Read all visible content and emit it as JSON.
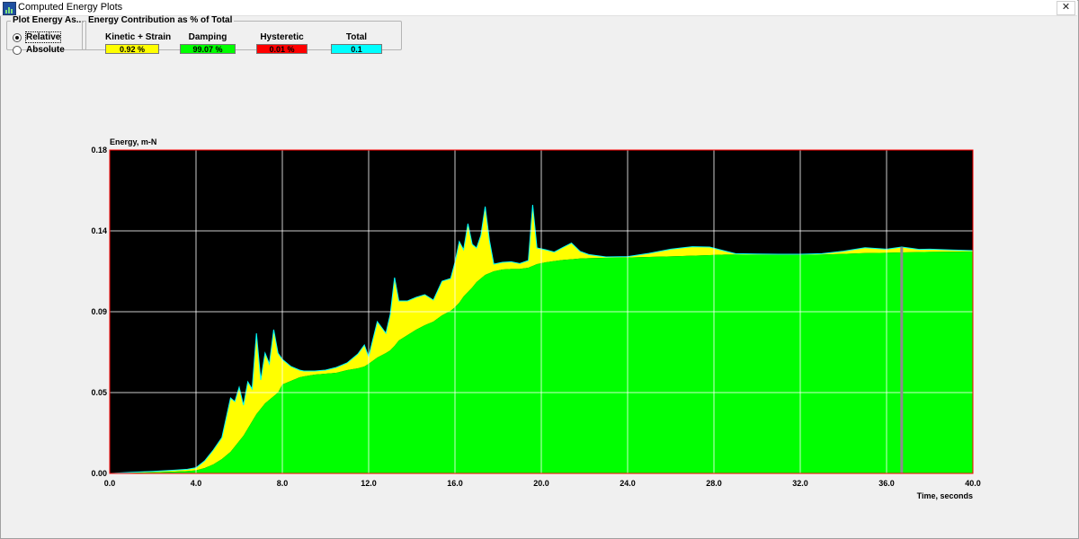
{
  "window": {
    "title": "Computed Energy Plots",
    "close_icon": "close-icon",
    "app_icon": "chart-app-icon"
  },
  "plot_mode": {
    "legend": "Plot Energy As...",
    "options": [
      {
        "label": "Relative",
        "checked": true
      },
      {
        "label": "Absolute",
        "checked": false
      }
    ]
  },
  "contribution": {
    "legend": "Energy Contribution as % of Total",
    "items": [
      {
        "label": "Kinetic + Strain",
        "value": "0.92 %",
        "color": "#ffff00"
      },
      {
        "label": "Damping",
        "value": "99.07 %",
        "color": "#00ff00"
      },
      {
        "label": "Hysteretic",
        "value": "0.01 %",
        "color": "#ff0000"
      },
      {
        "label": "Total",
        "value": "0.1",
        "color": "#00ffff"
      }
    ]
  },
  "colors": {
    "plot_background": "#000000",
    "plot_border": "#ff0000",
    "grid": "#ffffff",
    "cursor": "#8c8c8c",
    "damping": "#00ff00",
    "kinetic": "#ffff00",
    "total_outline": "#00ffff"
  },
  "chart_data": {
    "type": "area",
    "stacked": true,
    "ylabel": "Energy, m-N",
    "xlabel": "Time, seconds",
    "xlim": [
      0,
      40
    ],
    "ylim": [
      0,
      0.18
    ],
    "xticks": [
      0,
      4,
      8,
      12,
      16,
      20,
      24,
      28,
      32,
      36,
      40
    ],
    "xtick_labels": [
      "0.0",
      "4.0",
      "8.0",
      "12.0",
      "16.0",
      "20.0",
      "24.0",
      "28.0",
      "32.0",
      "36.0",
      "40.0"
    ],
    "yticks": [
      0,
      0.045,
      0.09,
      0.135,
      0.18
    ],
    "ytick_labels": [
      "0.00",
      "0.05",
      "0.09",
      "0.14",
      "0.18"
    ],
    "grid": true,
    "cursor_x": 36.7,
    "x": [
      0,
      1,
      2,
      3,
      3.6,
      4,
      4.4,
      4.8,
      5.2,
      5.6,
      5.8,
      6.0,
      6.2,
      6.4,
      6.6,
      6.8,
      7.0,
      7.2,
      7.4,
      7.6,
      7.8,
      8.0,
      8.4,
      8.8,
      9.0,
      9.5,
      10,
      10.5,
      11,
      11.5,
      11.8,
      12.0,
      12.4,
      12.8,
      13.0,
      13.2,
      13.4,
      13.8,
      14.2,
      14.6,
      15.0,
      15.4,
      15.8,
      16.0,
      16.2,
      16.4,
      16.6,
      16.8,
      17.0,
      17.2,
      17.4,
      17.6,
      17.8,
      18.2,
      18.6,
      19.0,
      19.4,
      19.6,
      19.8,
      20.2,
      20.6,
      21.0,
      21.4,
      21.8,
      22.2,
      23,
      24,
      25,
      26,
      27,
      27.8,
      28.5,
      29,
      30,
      31,
      32,
      33,
      34,
      35,
      36,
      36.7,
      37.5,
      38,
      39,
      40
    ],
    "series": [
      {
        "name": "Damping",
        "color": "#00ff00",
        "values": [
          0.0,
          0.0003,
          0.0006,
          0.001,
          0.0013,
          0.0017,
          0.003,
          0.005,
          0.008,
          0.012,
          0.015,
          0.018,
          0.021,
          0.025,
          0.029,
          0.033,
          0.036,
          0.039,
          0.041,
          0.043,
          0.045,
          0.0495,
          0.0515,
          0.0535,
          0.054,
          0.055,
          0.0555,
          0.056,
          0.0575,
          0.0585,
          0.0595,
          0.061,
          0.0645,
          0.067,
          0.0685,
          0.071,
          0.074,
          0.077,
          0.08,
          0.0825,
          0.0845,
          0.088,
          0.0905,
          0.0925,
          0.095,
          0.0985,
          0.101,
          0.1035,
          0.1065,
          0.1085,
          0.1105,
          0.1115,
          0.1125,
          0.1135,
          0.1138,
          0.1138,
          0.1145,
          0.1155,
          0.1165,
          0.1175,
          0.1182,
          0.1188,
          0.1192,
          0.1196,
          0.1198,
          0.12,
          0.1202,
          0.1205,
          0.1208,
          0.1212,
          0.1215,
          0.1218,
          0.1218,
          0.1217,
          0.1216,
          0.1216,
          0.1218,
          0.1222,
          0.1226,
          0.1228,
          0.123,
          0.1232,
          0.1233,
          0.1234,
          0.1235
        ]
      },
      {
        "name": "Kinetic + Strain",
        "color": "#ffff00",
        "values": [
          0.0,
          0.0003,
          0.0005,
          0.0008,
          0.001,
          0.0015,
          0.004,
          0.008,
          0.012,
          0.03,
          0.025,
          0.03,
          0.017,
          0.026,
          0.018,
          0.045,
          0.016,
          0.028,
          0.02,
          0.037,
          0.022,
          0.014,
          0.008,
          0.004,
          0.003,
          0.002,
          0.002,
          0.003,
          0.004,
          0.008,
          0.012,
          0.004,
          0.02,
          0.011,
          0.02,
          0.038,
          0.022,
          0.019,
          0.018,
          0.017,
          0.012,
          0.019,
          0.018,
          0.025,
          0.034,
          0.026,
          0.038,
          0.024,
          0.019,
          0.024,
          0.038,
          0.018,
          0.004,
          0.004,
          0.004,
          0.003,
          0.004,
          0.034,
          0.009,
          0.007,
          0.005,
          0.007,
          0.009,
          0.004,
          0.002,
          0.0005,
          0.0005,
          0.002,
          0.004,
          0.005,
          0.0045,
          0.002,
          0.0005,
          0.0004,
          0.0004,
          0.0004,
          0.0005,
          0.0015,
          0.003,
          0.002,
          0.003,
          0.0015,
          0.0015,
          0.001,
          0.0005
        ]
      }
    ]
  }
}
